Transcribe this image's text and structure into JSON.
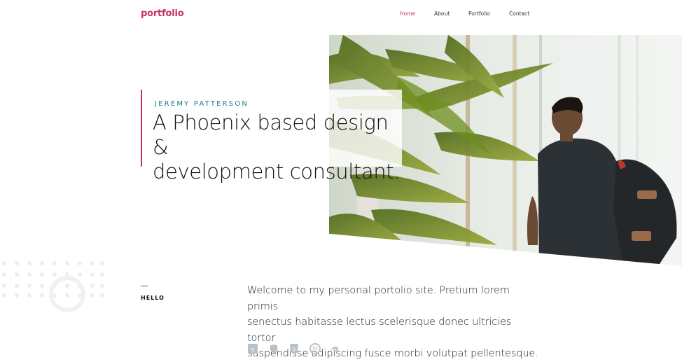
{
  "header": {
    "logo": "portfolio",
    "nav": [
      "Home",
      "About",
      "Portfolio",
      "Contact"
    ],
    "active_index": 0
  },
  "hero": {
    "eyebrow": "JEREMY PATTERSON",
    "headline_line1": "A Phoenix based design &",
    "headline_line2": "development consultant."
  },
  "about": {
    "label": "HELLO",
    "intro_line1": "Welcome to my personal portolio site. Pretium lorem primis",
    "intro_line2": "senectus habitasse lectus scelerisque donec ultricies tortor",
    "intro_line3": "suspendisse adipiscing fusce morbi volutpat pellentesque.",
    "tech_icons": [
      "html5-icon",
      "grunt-icon",
      "css3-icon",
      "wordpress-icon",
      "sass-icon"
    ]
  },
  "colors": {
    "brand": "#c9325c",
    "accent_teal": "#1f7c84",
    "nav_text": "#333333",
    "icon_gray": "#b9c2c9",
    "dot_gray": "#eeeeef"
  }
}
